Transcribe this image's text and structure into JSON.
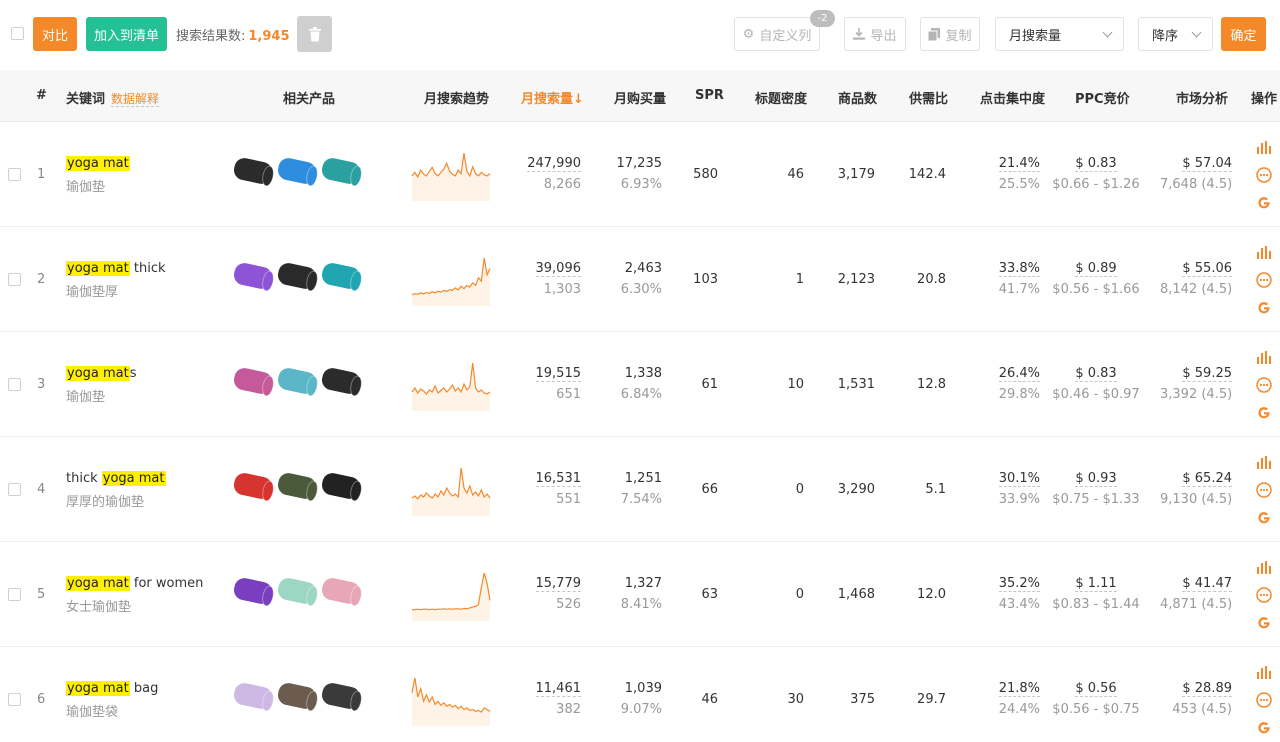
{
  "toolbar": {
    "compare_label": "对比",
    "add_list_label": "加入到清单",
    "result_label": "搜索结果数:",
    "result_count": "1,945",
    "custom_columns_label": "自定义列",
    "custom_badge": "-2",
    "export_label": "导出",
    "copy_label": "复制",
    "sort_field": "月搜索量",
    "sort_order": "降序",
    "confirm_label": "确定"
  },
  "columns": {
    "index": "#",
    "keyword": "关键词",
    "keyword_help": "数据解释",
    "products": "相关产品",
    "trend": "月搜索趋势",
    "searches": "月搜索量↓",
    "purchases": "月购买量",
    "spr": "SPR",
    "title_density": "标题密度",
    "product_count": "商品数",
    "supply_demand": "供需比",
    "click_concentration": "点击集中度",
    "ppc": "PPC竞价",
    "market": "市场分析",
    "actions": "操作"
  },
  "colors": {
    "accent": "#f5892a",
    "green": "#25c095",
    "highlight": "#ffef00"
  },
  "rows": [
    {
      "index": "1",
      "kw_pre": "",
      "kw_hl": "yoga mat",
      "kw_post": "",
      "kw_cn": "瑜伽垫",
      "searches": "247,990",
      "searches_sub": "8,266",
      "purchases": "17,235",
      "purchases_sub": "6.93%",
      "spr": "580",
      "title_density": "46",
      "product_count": "3,179",
      "supply_demand": "142.4",
      "click": "21.4%",
      "click_sub": "25.5%",
      "ppc": "$ 0.83",
      "ppc_range": "$0.66 - $1.26",
      "market": "$ 57.04",
      "market_sub": "7,648 (4.5)",
      "trend": [
        30,
        36,
        28,
        40,
        33,
        30,
        38,
        45,
        34,
        30,
        36,
        42,
        52,
        38,
        33,
        30,
        40,
        34,
        70,
        38,
        30,
        46,
        34,
        30,
        36,
        32,
        30,
        34
      ],
      "products": [
        "#2b2b2b",
        "#2f8de0",
        "#2aa0a0"
      ]
    },
    {
      "index": "2",
      "kw_pre": "",
      "kw_hl": "yoga mat",
      "kw_post": " thick",
      "kw_cn": "瑜伽垫厚",
      "searches": "39,096",
      "searches_sub": "1,303",
      "purchases": "2,463",
      "purchases_sub": "6.30%",
      "spr": "103",
      "title_density": "1",
      "product_count": "2,123",
      "supply_demand": "20.8",
      "click": "33.8%",
      "click_sub": "41.7%",
      "ppc": "$ 0.89",
      "ppc_range": "$0.56 - $1.66",
      "market": "$ 55.06",
      "market_sub": "8,142 (4.5)",
      "trend": [
        8,
        10,
        9,
        12,
        10,
        13,
        11,
        15,
        12,
        16,
        14,
        18,
        16,
        20,
        18,
        24,
        19,
        28,
        22,
        30,
        26,
        36,
        30,
        48,
        40,
        95,
        55,
        70
      ],
      "products": [
        "#8e54d6",
        "#2a2a2a",
        "#1fa6b0"
      ]
    },
    {
      "index": "3",
      "kw_pre": "",
      "kw_hl": "yoga mat",
      "kw_post": "s",
      "kw_cn": "瑜伽垫",
      "searches": "19,515",
      "searches_sub": "651",
      "purchases": "1,338",
      "purchases_sub": "6.84%",
      "spr": "61",
      "title_density": "10",
      "product_count": "1,531",
      "supply_demand": "12.8",
      "click": "26.4%",
      "click_sub": "29.8%",
      "ppc": "$ 0.83",
      "ppc_range": "$0.46 - $0.97",
      "market": "$ 59.25",
      "market_sub": "3,392 (4.5)",
      "trend": [
        22,
        30,
        20,
        28,
        24,
        18,
        26,
        22,
        34,
        20,
        25,
        30,
        22,
        28,
        36,
        24,
        30,
        22,
        38,
        26,
        32,
        80,
        30,
        22,
        26,
        20,
        18,
        22
      ],
      "products": [
        "#c45a9a",
        "#5bb6c8",
        "#2b2b2b"
      ]
    },
    {
      "index": "4",
      "kw_pre": "thick ",
      "kw_hl": "yoga mat",
      "kw_post": "",
      "kw_cn": "厚厚的瑜伽垫",
      "searches": "16,531",
      "searches_sub": "551",
      "purchases": "1,251",
      "purchases_sub": "7.54%",
      "spr": "66",
      "title_density": "0",
      "product_count": "3,290",
      "supply_demand": "5.1",
      "click": "30.1%",
      "click_sub": "33.9%",
      "ppc": "$ 0.93",
      "ppc_range": "$0.75 - $1.33",
      "market": "$ 65.24",
      "market_sub": "9,130 (4.5)",
      "trend": [
        20,
        24,
        18,
        26,
        22,
        30,
        24,
        20,
        28,
        22,
        34,
        26,
        40,
        30,
        24,
        28,
        22,
        80,
        40,
        30,
        44,
        26,
        32,
        24,
        36,
        22,
        28,
        20
      ],
      "products": [
        "#d8342f",
        "#4a5a3a",
        "#222222"
      ]
    },
    {
      "index": "5",
      "kw_pre": "",
      "kw_hl": "yoga mat",
      "kw_post": " for women",
      "kw_cn": "女士瑜伽垫",
      "searches": "15,779",
      "searches_sub": "526",
      "purchases": "1,327",
      "purchases_sub": "8.41%",
      "spr": "63",
      "title_density": "0",
      "product_count": "1,468",
      "supply_demand": "12.0",
      "click": "35.2%",
      "click_sub": "43.4%",
      "ppc": "$ 1.11",
      "ppc_range": "$0.83 - $1.44",
      "market": "$ 41.47",
      "market_sub": "4,871 (4.5)",
      "trend": [
        8,
        8,
        9,
        8,
        9,
        9,
        8,
        9,
        8,
        9,
        9,
        10,
        9,
        10,
        9,
        10,
        10,
        9,
        11,
        10,
        12,
        14,
        16,
        20,
        60,
        95,
        70,
        30
      ],
      "products": [
        "#7a3fc0",
        "#9ed6c4",
        "#e8a7b8"
      ]
    },
    {
      "index": "6",
      "kw_pre": "",
      "kw_hl": "yoga mat",
      "kw_post": " bag",
      "kw_cn": "瑜伽垫袋",
      "searches": "11,461",
      "searches_sub": "382",
      "purchases": "1,039",
      "purchases_sub": "9.07%",
      "spr": "46",
      "title_density": "30",
      "product_count": "375",
      "supply_demand": "29.7",
      "click": "21.8%",
      "click_sub": "24.4%",
      "ppc": "$ 0.56",
      "ppc_range": "$0.56 - $0.75",
      "market": "$ 28.89",
      "market_sub": "453 (4.5)",
      "trend": [
        60,
        95,
        50,
        70,
        40,
        55,
        38,
        50,
        32,
        40,
        30,
        36,
        28,
        32,
        26,
        30,
        22,
        28,
        20,
        24,
        18,
        20,
        16,
        18,
        14,
        24,
        20,
        16
      ],
      "products": [
        "#cdb9e3",
        "#6b5c4f",
        "#3a3a3a"
      ]
    }
  ]
}
